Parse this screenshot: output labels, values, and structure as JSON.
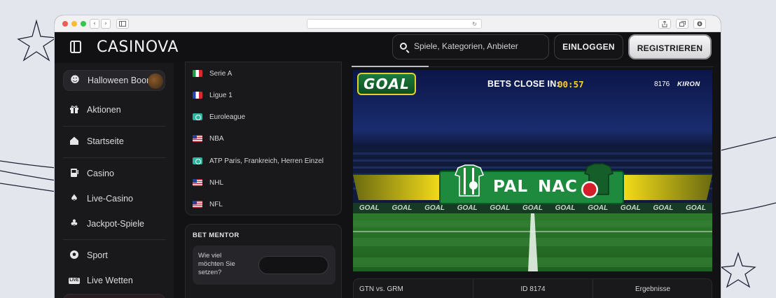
{
  "browser": {
    "back_glyph": "‹",
    "forward_glyph": "›",
    "reload_glyph": "↻"
  },
  "header": {
    "logo": "CASINOVA",
    "search_placeholder": "Spiele, Kategorien, Anbieter",
    "login_label": "EINLOGGEN",
    "register_label": "REGISTRIEREN"
  },
  "sidebar": {
    "items": [
      {
        "label": "Halloween Boom",
        "icon": "pumpkin-icon",
        "glyph": "☻"
      },
      {
        "label": "Aktionen",
        "icon": "gift-icon",
        "glyph": "🎁"
      },
      {
        "label": "Startseite",
        "icon": "home-icon",
        "glyph": "⌂"
      },
      {
        "label": "Casino",
        "icon": "slot-machine-icon",
        "glyph": "▤"
      },
      {
        "label": "Live-Casino",
        "icon": "live-dealer-icon",
        "glyph": "♠"
      },
      {
        "label": "Jackpot-Spiele",
        "icon": "clover-icon",
        "glyph": "♣"
      },
      {
        "label": "Sport",
        "icon": "soccer-ball-icon",
        "glyph": "⚽"
      },
      {
        "label": "Live Wetten",
        "icon": "live-badge-icon",
        "glyph": "LIVE"
      }
    ]
  },
  "leagues": [
    {
      "name": "Serie A",
      "flag": "italy-flag-icon"
    },
    {
      "name": "Ligue 1",
      "flag": "france-flag-icon"
    },
    {
      "name": "Euroleague",
      "flag": "world-icon"
    },
    {
      "name": "NBA",
      "flag": "usa-flag-icon"
    },
    {
      "name": "ATP Paris, Frankreich, Herren Einzel",
      "flag": "world-icon"
    },
    {
      "name": "NHL",
      "flag": "usa-flag-icon"
    },
    {
      "name": "NFL",
      "flag": "usa-flag-icon"
    }
  ],
  "bet_mentor": {
    "title": "BET MENTOR",
    "question": "Wie viel möchten Sie setzen?",
    "input_value": ""
  },
  "game": {
    "badge": "GOAL",
    "bets_close_label": "BETS CLOSE IN:",
    "timer": "00:57",
    "game_number": "8176",
    "provider": "KIRON",
    "home_team": "PAL",
    "away_team": "NAC",
    "ad_board_text": "GOAL"
  },
  "info_bar": {
    "match": "GTN vs. GRM",
    "id": "ID 8174",
    "results": "Ergebnisse"
  },
  "colors": {
    "accent_yellow": "#ffd21a",
    "banner_green": "#1d8a3e",
    "home_color": "#1d8a3e",
    "away_color": "#d21f2a"
  }
}
